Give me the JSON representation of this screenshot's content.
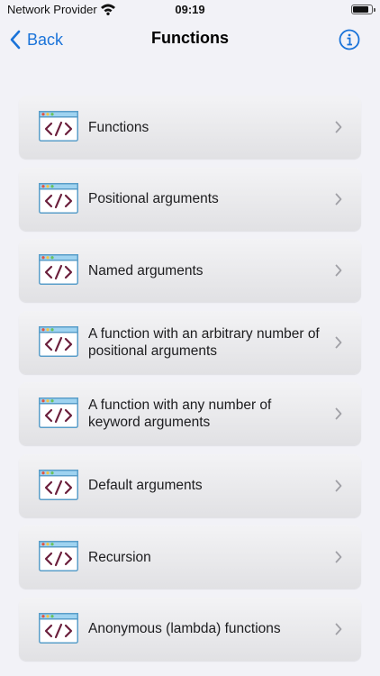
{
  "status_bar": {
    "carrier": "Network Provider",
    "time": "09:19",
    "battery_level": 0.85
  },
  "nav": {
    "back_label": "Back",
    "title": "Functions",
    "info_icon": "info-circle-icon"
  },
  "colors": {
    "accent": "#1a73d9",
    "background": "#f2f2f7",
    "code_icon_frame": "#5a9ec9",
    "code_icon_text": "#6b1f3c"
  },
  "items": [
    {
      "label": "Functions"
    },
    {
      "label": "Positional arguments"
    },
    {
      "label": "Named arguments"
    },
    {
      "label": "A function with an arbitrary number of positional arguments"
    },
    {
      "label": "A function with any number of keyword arguments"
    },
    {
      "label": "Default arguments"
    },
    {
      "label": "Recursion"
    },
    {
      "label": "Anonymous (lambda) functions"
    }
  ]
}
